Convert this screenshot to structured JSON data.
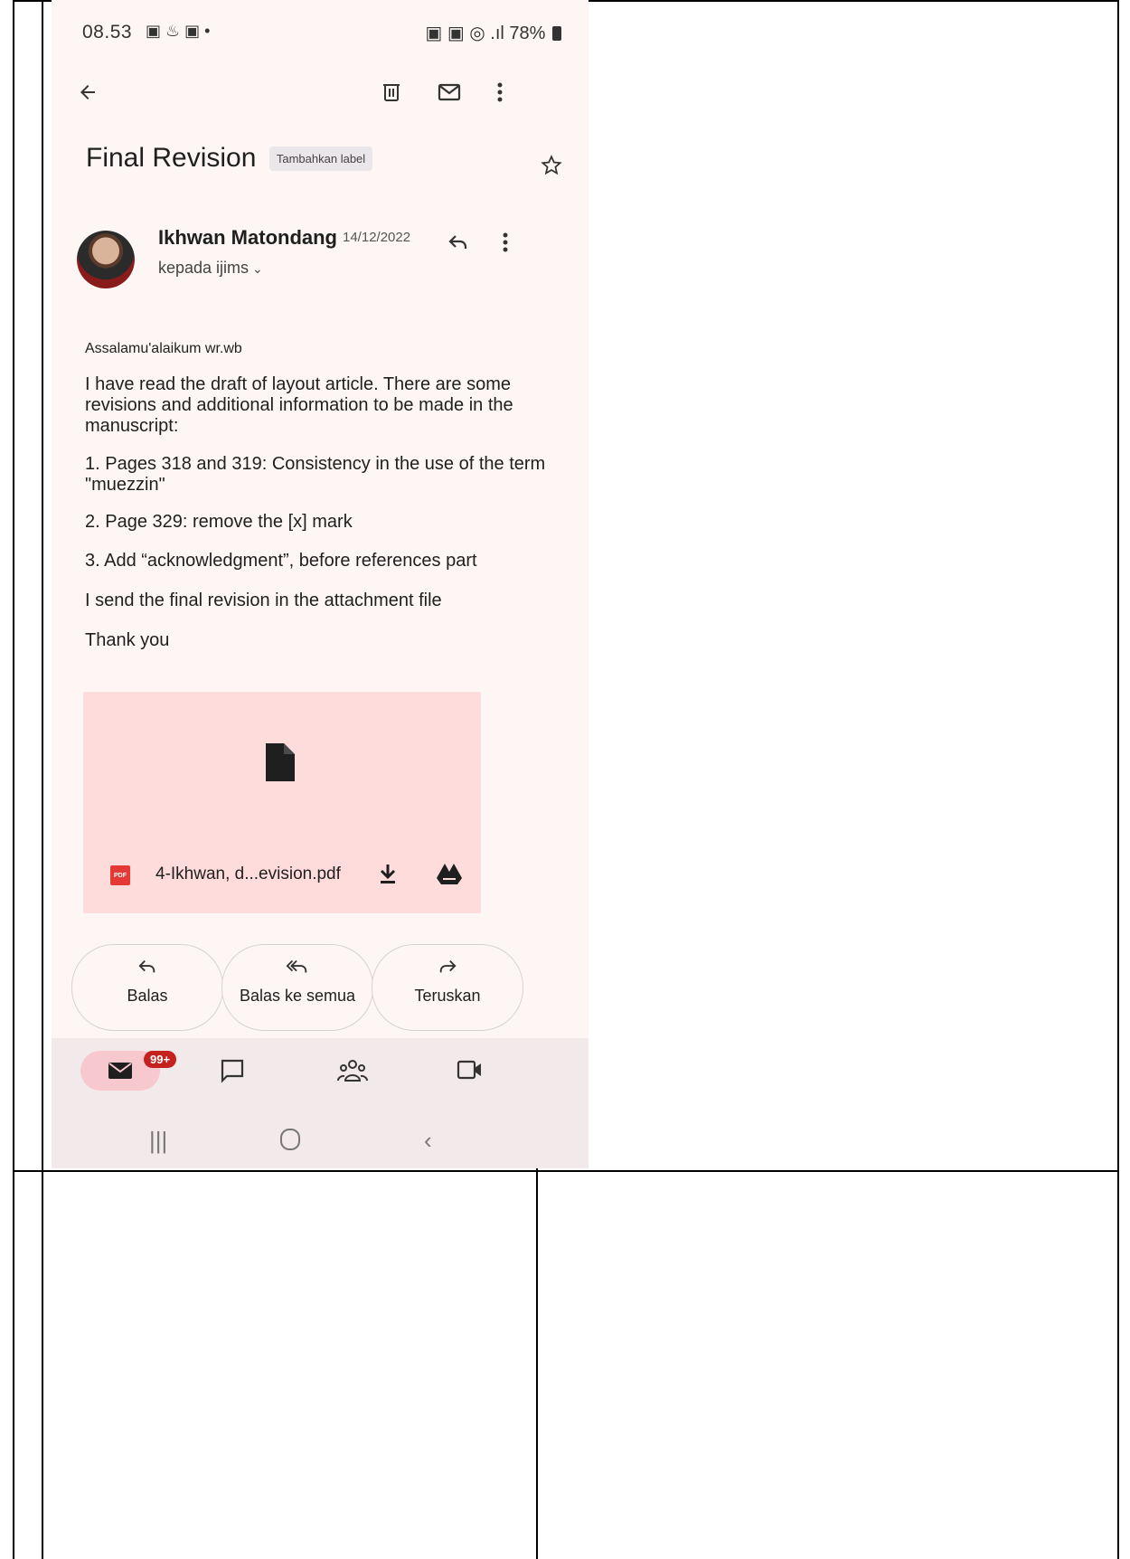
{
  "status_bar": {
    "time": "08.53",
    "left_icons": "▣ ♨ ▣ •",
    "right_icons": "▣ ▣ ◎ .ıl",
    "battery": "78%"
  },
  "top_bar": {
    "back_icon": "arrow-left-icon",
    "delete_icon": "trash-icon",
    "mark_unread_icon": "envelope-icon",
    "more_icon": "more-vert-icon"
  },
  "email": {
    "subject": "Final Revision",
    "label_chip": "Tambahkan label",
    "sender_name": "Ikhwan Matondang",
    "date": "14/12/2022",
    "recipient": "kepada ijims",
    "body": [
      "Assalamu'alaikum wr.wb",
      "I have read the draft of layout article. There are some revisions and additional information to be made in the manuscript:",
      "1. Pages 318 and 319: Consistency in the use of the term \"muezzin\"",
      "2. Page 329: remove the [x] mark",
      "3. Add “acknowledgment”, before references part",
      "I send the final revision in the attachment file",
      "Thank you"
    ]
  },
  "attachment": {
    "type_badge": "PDF",
    "file_name": "4-Ikhwan, d...evision.pdf"
  },
  "actions": {
    "reply": "Balas",
    "reply_all": "Balas ke semua",
    "forward": "Teruskan"
  },
  "bottom_nav": {
    "mail_badge": "99+",
    "items": [
      "mail-icon",
      "chat-icon",
      "spaces-icon",
      "meet-icon"
    ]
  },
  "colors": {
    "background": "#fdf6f4",
    "attachment_bg": "#ffdcdc",
    "badge_red": "#c5221f",
    "nav_bg": "#f2e9ea",
    "nav_active": "#f7c9cf"
  }
}
